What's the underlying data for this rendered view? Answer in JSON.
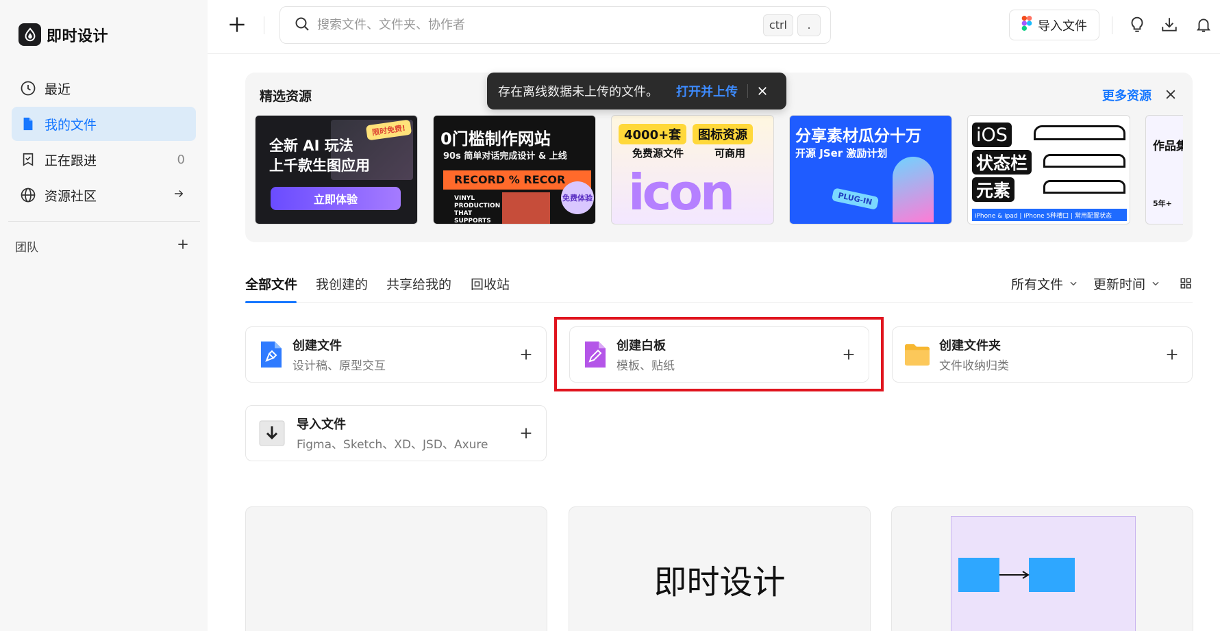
{
  "app": {
    "name": "即时设计"
  },
  "sidebar": {
    "items": [
      {
        "label": "最近",
        "icon": "clock-icon"
      },
      {
        "label": "我的文件",
        "icon": "file-icon",
        "active": true
      },
      {
        "label": "正在跟进",
        "icon": "bookmark-check-icon",
        "count": "0"
      },
      {
        "label": "资源社区",
        "icon": "globe-icon"
      }
    ],
    "team_label": "团队"
  },
  "topbar": {
    "search_placeholder": "搜索文件、文件夹、协作者",
    "shortcut_keys": [
      "ctrl",
      "."
    ],
    "import_label": "导入文件"
  },
  "featured": {
    "title": "精选资源",
    "more_label": "更多资源",
    "banners": [
      {
        "line1": "全新 AI 玩法",
        "line2": "上千款生图应用",
        "badge": "限时免费!",
        "cta": "立即体验"
      },
      {
        "line1": "0门槛制作网站",
        "line2": "90s 简单对话完成设计 & 上线",
        "strip": "RECORD % RECOR",
        "small": "VINYL PRODUCTION THAT SUPPORTS",
        "badge": "免费体验"
      },
      {
        "line1": "4000+套",
        "line1b": "图标资源",
        "line2a": "免费源文件",
        "line2b": "可商用",
        "art": "icon"
      },
      {
        "line1": "分享素材瓜分十万",
        "line2": "开源 JSer 激励计划",
        "badge": "PLUG-IN"
      },
      {
        "line1": "iOS",
        "line2": "状态栏",
        "line3": "元素",
        "footer": "iPhone & ipad | iPhone 5种槽口 | 常用配置状态"
      },
      {
        "line1": "作品集",
        "line2": "5年+"
      }
    ]
  },
  "toast": {
    "message": "存在离线数据未上传的文件。",
    "action": "打开并上传"
  },
  "tabs": [
    {
      "label": "全部文件",
      "active": true
    },
    {
      "label": "我创建的"
    },
    {
      "label": "共享给我的"
    },
    {
      "label": "回收站"
    }
  ],
  "filters": {
    "type": "所有文件",
    "sort": "更新时间"
  },
  "create_cards": [
    {
      "title": "创建文件",
      "subtitle": "设计稿、原型交互"
    },
    {
      "title": "创建白板",
      "subtitle": "模板、贴纸"
    },
    {
      "title": "创建文件夹",
      "subtitle": "文件收纳归类"
    },
    {
      "title": "导入文件",
      "subtitle": "Figma、Sketch、XD、JSD、Axure"
    }
  ],
  "thumbnails": [
    {
      "text": ""
    },
    {
      "text": "即时设计"
    },
    {
      "text": ""
    }
  ],
  "colors": {
    "accent": "#1677ff",
    "highlight": "#e0141e",
    "toast_bg": "#2b2b2b"
  }
}
